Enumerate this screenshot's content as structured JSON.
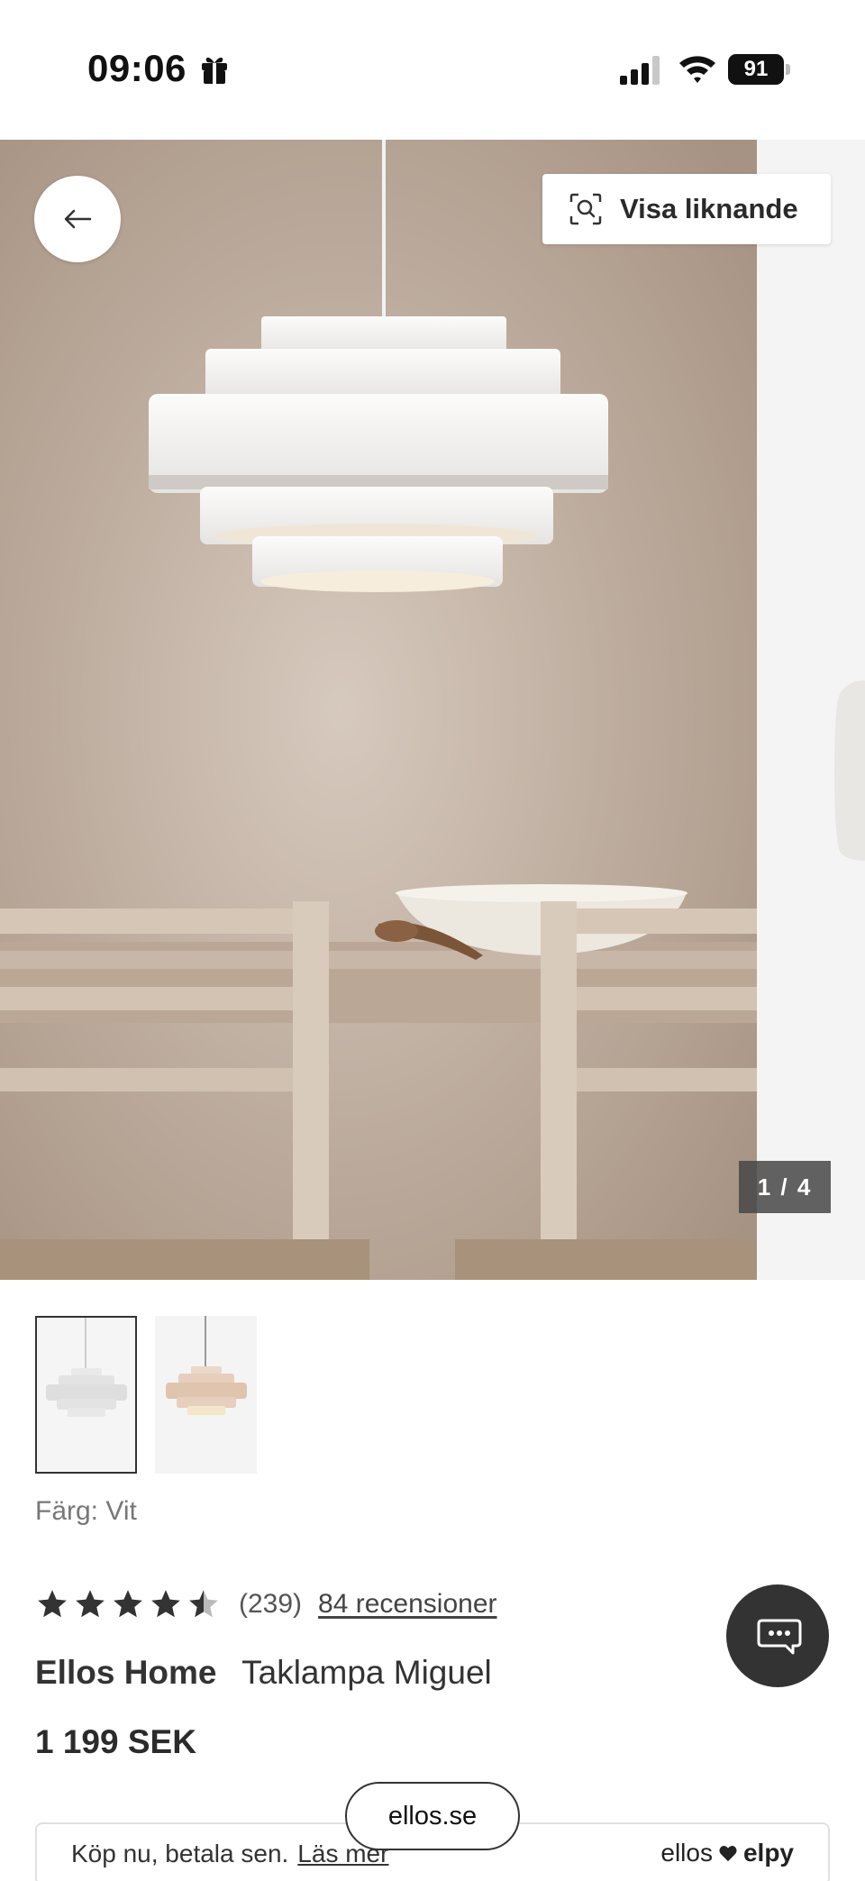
{
  "status_bar": {
    "time": "09:06",
    "battery": "91"
  },
  "gallery": {
    "similar_button_label": "Visa liknande",
    "counter": "1 / 4"
  },
  "product": {
    "color_line": "Färg: Vit",
    "rating_value": 4.5,
    "review_count": "(239)",
    "reviews_link": "84 recensioner",
    "brand": "Ellos Home",
    "name": "Taklampa Miguel",
    "price": "1 199 SEK"
  },
  "paylater": {
    "text": "Köp nu, betala sen.",
    "link": "Läs mer",
    "brand_left": "ellos",
    "brand_right": "elpy"
  },
  "browser": {
    "url": "ellos.se"
  },
  "colors": {
    "wall": "#b9a696",
    "accent": "#333333"
  },
  "icons": [
    "gift-icon",
    "signal-icon",
    "wifi-icon",
    "back-arrow-icon",
    "visual-search-icon",
    "star-icon",
    "chat-icon",
    "heart-icon"
  ]
}
